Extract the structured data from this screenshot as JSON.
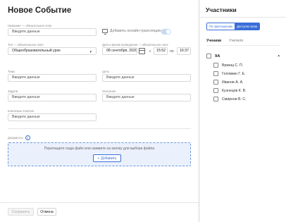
{
  "event": {
    "title": "Новое Событие",
    "name_label": "Название — обязательное поле",
    "name_placeholder": "Введите данные",
    "online_label": "Добавить онлайн-трансляцию",
    "type_label": "Тип — обязательное поле",
    "type_value": "Общеобразовательный урок",
    "datetime_label": "Дата и время проведения — обязательное поле",
    "date_value": "08 сентября, 2020",
    "from_label": "с",
    "time_from": "15:52",
    "to_label": "по",
    "time_to": "16:37",
    "topic_label": "Тема",
    "topic_placeholder": "Введите данные",
    "goal_label": "Цель",
    "goal_placeholder": "Введите данные",
    "task_label": "Задачи",
    "task_placeholder": "Введите данные",
    "description_label": "Описание",
    "description_placeholder": "Введите данные",
    "keywords_label": "Ключевые понятия",
    "keywords_placeholder": "Введите данные",
    "documents_label": "Документы",
    "dropzone_text": "Перетащите сюда файл или нажмите на кнопку для выбора файла",
    "add_button": "Добавить",
    "save_button": "Сохранить",
    "cancel_button": "Отмена"
  },
  "participants": {
    "title": "Участники",
    "invite_option": "По приглашению",
    "all_option": "Доступно всем",
    "tabs": [
      "Ученики",
      "Учителя"
    ],
    "group_name": "9А",
    "students": [
      "Вржещ С. П.",
      "Головкин Г. Е.",
      "Иванов А. А.",
      "Кузнецов К. В.",
      "Смирнов В. С."
    ]
  },
  "icons": {
    "online": "monitor-icon",
    "calendar": "calendar-icon",
    "chevron": "chevron-down-icon",
    "info": "info-icon",
    "group_toggle": "chevron-up-icon"
  },
  "colors": {
    "accent": "#3a6ed8",
    "dropzone_bg": "#eaf1fc"
  }
}
